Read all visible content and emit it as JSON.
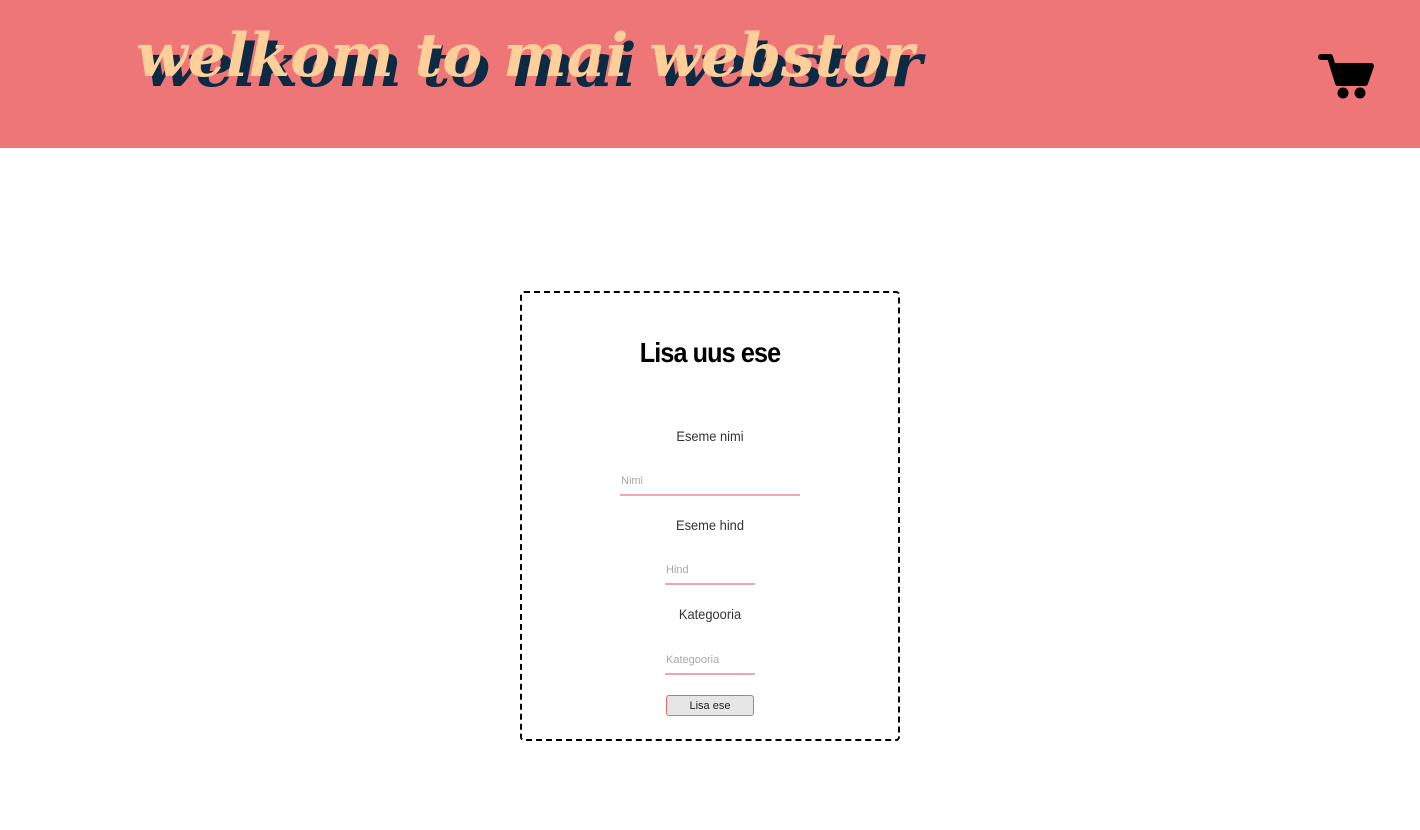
{
  "header": {
    "title": "welkom to mai webstor",
    "cart_icon": "shopping-cart-icon"
  },
  "form": {
    "title": "Lisa uus ese",
    "name_label": "Eseme nimi",
    "name_placeholder": "Nimi",
    "price_label": "Eseme hind",
    "price_placeholder": "Hind",
    "category_label": "Kategooria",
    "category_placeholder": "Kategooria",
    "submit_label": "Lisa ese"
  },
  "colors": {
    "header_bg": "#ef7676",
    "title_fill": "#ffcf99",
    "title_shadow": "#0d2a45",
    "input_underline": "#f2a5ac",
    "button_border": "#e26a6a"
  }
}
